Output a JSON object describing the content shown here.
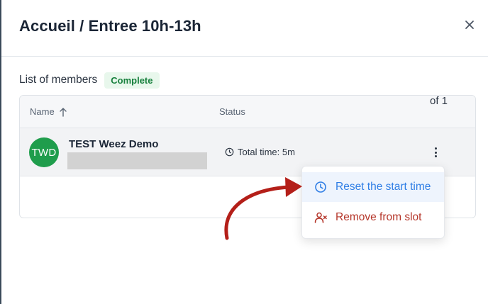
{
  "modal": {
    "title": "Accueil / Entree 10h-13h",
    "close_icon": "close-icon"
  },
  "members": {
    "label": "List of members",
    "badge": "Complete"
  },
  "table": {
    "columns": {
      "name": "Name",
      "status": "Status"
    },
    "rows": [
      {
        "initials": "TWD",
        "name": "TEST Weez Demo",
        "time": "Total time: 5m"
      }
    ],
    "pagination": "of 1"
  },
  "menu": {
    "reset": "Reset the start time",
    "remove": "Remove from slot"
  },
  "colors": {
    "avatar": "#1f9d4c",
    "badge_bg": "#e8f7ec",
    "badge_text": "#17803d",
    "reset_text": "#2f7ee5",
    "remove_text": "#b5362a",
    "annotation_arrow": "#b41f19"
  }
}
